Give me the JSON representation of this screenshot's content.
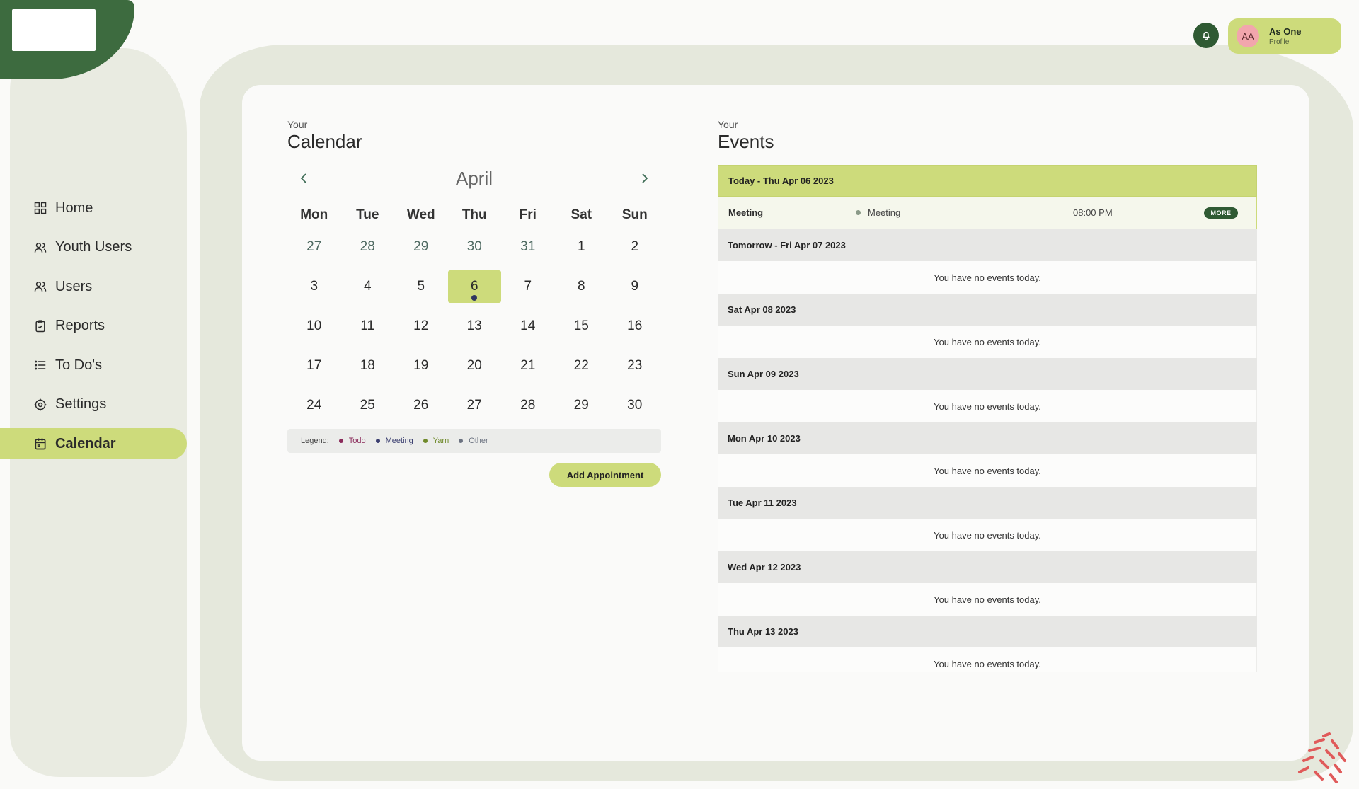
{
  "colors": {
    "accent": "#cddb7b",
    "brand_dark": "#2f5a33",
    "todo": "#8a2a5a",
    "meeting": "#3b3f70",
    "yarn": "#6f8a2a",
    "other": "#6b7280"
  },
  "header": {
    "notification_icon": "bell-icon",
    "profile": {
      "initials": "AA",
      "name": "As One",
      "role": "Profile"
    }
  },
  "sidebar": {
    "items": [
      {
        "label": "Home",
        "icon": "dashboard-icon"
      },
      {
        "label": "Youth Users",
        "icon": "users-icon"
      },
      {
        "label": "Users",
        "icon": "users-icon"
      },
      {
        "label": "Reports",
        "icon": "clipboard-icon"
      },
      {
        "label": "To Do's",
        "icon": "list-icon"
      },
      {
        "label": "Settings",
        "icon": "gear-icon"
      },
      {
        "label": "Calendar",
        "icon": "calendar-icon",
        "active": true
      }
    ]
  },
  "calendar": {
    "eyebrow": "Your",
    "title": "Calendar",
    "month": "April",
    "weekdays": [
      "Mon",
      "Tue",
      "Wed",
      "Thu",
      "Fri",
      "Sat",
      "Sun"
    ],
    "weeks": [
      [
        "27",
        "28",
        "29",
        "30",
        "31",
        "1",
        "2"
      ],
      [
        "3",
        "4",
        "5",
        "6",
        "7",
        "8",
        "9"
      ],
      [
        "10",
        "11",
        "12",
        "13",
        "14",
        "15",
        "16"
      ],
      [
        "17",
        "18",
        "19",
        "20",
        "21",
        "22",
        "23"
      ],
      [
        "24",
        "25",
        "26",
        "27",
        "28",
        "29",
        "30"
      ]
    ],
    "legend": {
      "label": "Legend:",
      "items": [
        {
          "label": "Todo",
          "color": "#8a2a5a"
        },
        {
          "label": "Meeting",
          "color": "#3b3f70"
        },
        {
          "label": "Yarn",
          "color": "#6f8a2a"
        },
        {
          "label": "Other",
          "color": "#6b7280"
        }
      ]
    },
    "add_button": "Add Appointment"
  },
  "events": {
    "eyebrow": "Your",
    "title": "Events",
    "days": [
      {
        "heading": "Today - Thu Apr 06 2023",
        "today": true,
        "events": [
          {
            "title": "Meeting",
            "type": "Meeting",
            "time": "08:00 PM",
            "action": "MORE"
          }
        ]
      },
      {
        "heading": "Tomorrow - Fri Apr 07 2023",
        "empty": "You have no events today."
      },
      {
        "heading": "Sat Apr 08 2023",
        "empty": "You have no events today."
      },
      {
        "heading": "Sun Apr 09 2023",
        "empty": "You have no events today."
      },
      {
        "heading": "Mon Apr 10 2023",
        "empty": "You have no events today."
      },
      {
        "heading": "Tue Apr 11 2023",
        "empty": "You have no events today."
      },
      {
        "heading": "Wed Apr 12 2023",
        "empty": "You have no events today."
      },
      {
        "heading": "Thu Apr 13 2023",
        "empty": "You have no events today."
      }
    ]
  }
}
